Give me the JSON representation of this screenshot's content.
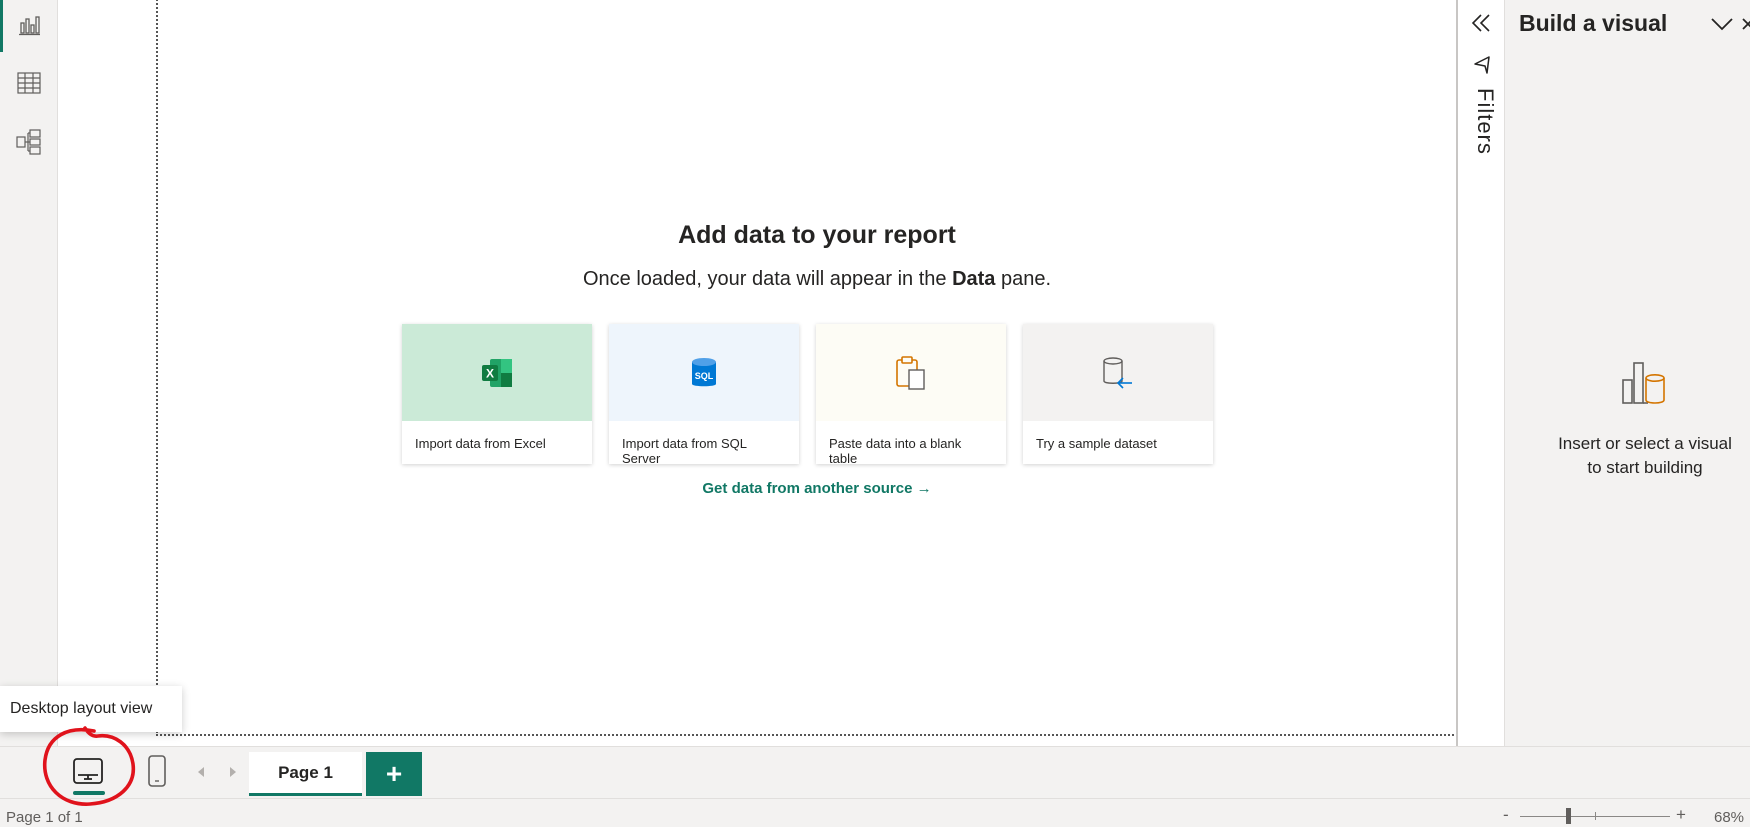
{
  "left_rail": {
    "items": [
      {
        "name": "report-view",
        "icon": "bar-chart-icon"
      },
      {
        "name": "table-view",
        "icon": "table-grid-icon"
      },
      {
        "name": "model-view",
        "icon": "model-diagram-icon"
      }
    ]
  },
  "canvas": {
    "title": "Add data to your report",
    "subtitle_prefix": "Once loaded, your data will appear in the ",
    "subtitle_bold": "Data",
    "subtitle_suffix": " pane.",
    "cards": [
      {
        "label": "Import data from Excel",
        "icon": "excel-icon",
        "color": "#cbead7"
      },
      {
        "label": "Import data from SQL Server",
        "icon": "sql-database-icon",
        "color": "#eef5fc"
      },
      {
        "label": "Paste data into a blank table",
        "icon": "paste-clipboard-icon",
        "color": "#fdfcf5"
      },
      {
        "label": "Try a sample dataset",
        "icon": "sample-database-icon",
        "color": "#f3f2f1"
      }
    ],
    "more_link": "Get data from another source →"
  },
  "filters": {
    "label": "Filters"
  },
  "viz_pane": {
    "title": "Build a visual",
    "empty_line1": "Insert or select a visual",
    "empty_line2": "to start building"
  },
  "pages": {
    "tab_label": "Page 1",
    "add_label": "+"
  },
  "status": {
    "page_info": "Page 1 of 1",
    "zoom": "68%",
    "zoom_level": 0.68
  },
  "tooltip": {
    "text": "Desktop layout view"
  },
  "colors": {
    "accent": "#117865",
    "annotation": "#e0131c"
  }
}
